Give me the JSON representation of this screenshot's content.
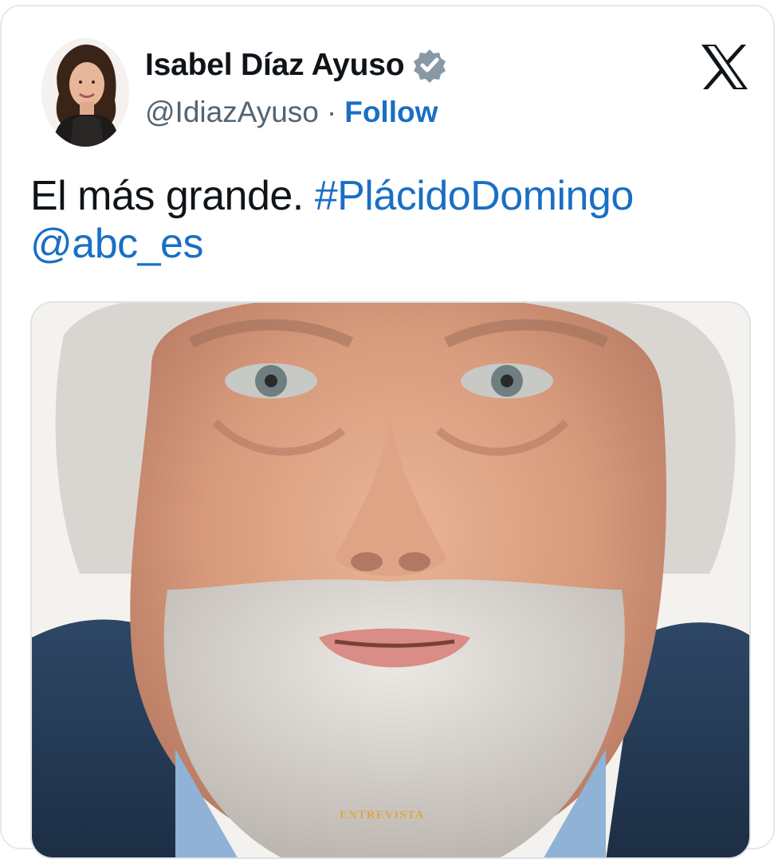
{
  "tweet": {
    "author_name": "Isabel Díaz Ayuso",
    "author_handle": "@IdiazAyuso",
    "separator": "·",
    "follow_label": "Follow",
    "text_plain": "El más grande. ",
    "hashtag": "#PlácidoDomingo",
    "mention": "@abc_es"
  },
  "media": {
    "caption": "ENTREVISTA"
  },
  "icons": {
    "verified": "verified-badge-icon",
    "brand": "x-logo-icon"
  },
  "colors": {
    "link": "#1a6fc4",
    "text": "#0f1419",
    "secondary": "#536471",
    "verified_badge": "#8899a6"
  }
}
